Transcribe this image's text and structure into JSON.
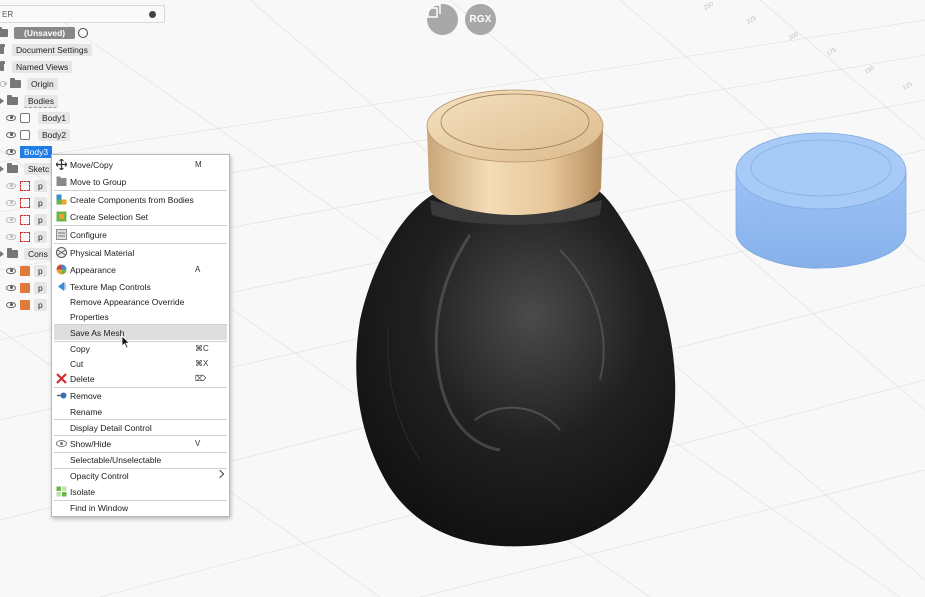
{
  "viewport_buttons": {
    "restore_label": "",
    "rgx_label": "RGX"
  },
  "browser": {
    "header_label": "ER",
    "document_label": "(Unsaved)",
    "rows": {
      "document_settings": "Document Settings",
      "named_views": "Named Views",
      "origin": "Origin",
      "bodies": "Bodies",
      "body1": "Body1",
      "body2": "Body2",
      "body3": "Body3",
      "sketches": "Sketc",
      "sketch_item": "p",
      "construction": "Cons",
      "construction_item": "p"
    }
  },
  "context_menu": {
    "items": [
      {
        "label": "Move/Copy",
        "shortcut": "M",
        "icon": "move-icon"
      },
      {
        "label": "Move to Group",
        "shortcut": "",
        "icon": "group-icon"
      },
      {
        "label": "Create Components from Bodies",
        "shortcut": "",
        "icon": "components-icon"
      },
      {
        "label": "Create Selection Set",
        "shortcut": "",
        "icon": "selection-set-icon"
      },
      {
        "label": "Configure",
        "shortcut": "",
        "icon": "configure-icon"
      },
      {
        "label": "Physical Material",
        "shortcut": "",
        "icon": "material-icon"
      },
      {
        "label": "Appearance",
        "shortcut": "A",
        "icon": "appearance-icon"
      },
      {
        "label": "Texture Map Controls",
        "shortcut": "",
        "icon": "texture-icon"
      },
      {
        "label": "Remove Appearance Override",
        "shortcut": "",
        "icon": ""
      },
      {
        "label": "Properties",
        "shortcut": "",
        "icon": ""
      },
      {
        "label": "Save As Mesh",
        "shortcut": "",
        "icon": ""
      },
      {
        "label": "Copy",
        "shortcut": "⌘C",
        "icon": ""
      },
      {
        "label": "Cut",
        "shortcut": "⌘X",
        "icon": ""
      },
      {
        "label": "Delete",
        "shortcut": "⌦",
        "icon": "delete-icon"
      },
      {
        "label": "Remove",
        "shortcut": "",
        "icon": "remove-icon"
      },
      {
        "label": "Rename",
        "shortcut": "",
        "icon": ""
      },
      {
        "label": "Display Detail Control",
        "shortcut": "",
        "icon": ""
      },
      {
        "label": "Show/Hide",
        "shortcut": "V",
        "icon": "eye-icon"
      },
      {
        "label": "Selectable/Unselectable",
        "shortcut": "",
        "icon": ""
      },
      {
        "label": "Opacity Control",
        "shortcut": "",
        "icon": ""
      },
      {
        "label": "Isolate",
        "shortcut": "",
        "icon": "isolate-icon"
      },
      {
        "label": "Find in Window",
        "shortcut": "",
        "icon": ""
      }
    ]
  },
  "grid_labels": [
    "250",
    "225",
    "200",
    "175",
    "150",
    "125"
  ],
  "colors": {
    "selection": "#1d7ee5",
    "highlight": "#dedede",
    "ghost_body": "#9fc4f4",
    "cap": "#e6c9a0",
    "jar": "#1a1a1a"
  }
}
